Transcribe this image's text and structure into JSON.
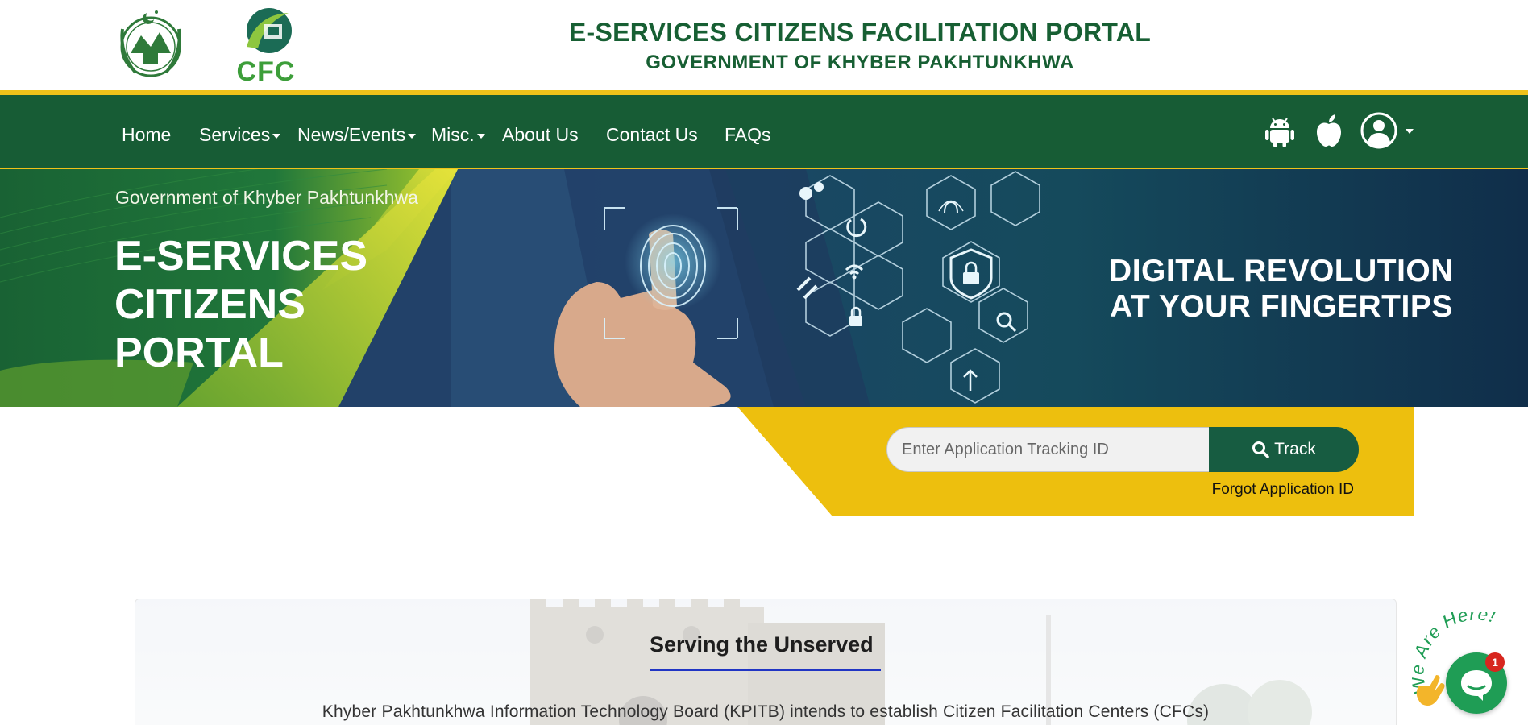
{
  "header": {
    "title": "E-SERVICES CITIZENS FACILITATION PORTAL",
    "subtitle": "GOVERNMENT OF KHYBER PAKHTUNKHWA",
    "cfc_logo_text": "CFC"
  },
  "nav": {
    "items": [
      {
        "label": "Home",
        "dropdown": false
      },
      {
        "label": "Services",
        "dropdown": true
      },
      {
        "label": "News/Events",
        "dropdown": true
      },
      {
        "label": "Misc.",
        "dropdown": true
      },
      {
        "label": "About Us",
        "dropdown": false
      },
      {
        "label": "Contact Us",
        "dropdown": false
      },
      {
        "label": "FAQs",
        "dropdown": false
      }
    ],
    "icons": [
      "android-icon",
      "apple-icon",
      "user-account-icon"
    ]
  },
  "hero": {
    "subtitle": "Government of Khyber Pakhtunkhwa",
    "title_lines": [
      "E-SERVICES",
      "CITIZENS",
      "PORTAL"
    ],
    "tagline_lines": [
      "DIGITAL REVOLUTION",
      "AT YOUR FINGERTIPS"
    ]
  },
  "track": {
    "placeholder": "Enter Application Tracking ID",
    "button_label": "Track",
    "forgot_label": "Forgot Application ID"
  },
  "section": {
    "title": "Serving the Unserved",
    "text": "Khyber Pakhtunkhwa Information Technology Board (KPITB) intends to establish Citizen Facilitation Centers (CFCs)"
  },
  "chat": {
    "banner": "We Are Here!",
    "unread_count": "1"
  },
  "colors": {
    "primary_green": "#175c35",
    "accent_yellow": "#efc21a",
    "title_green": "#175f33",
    "underline_blue": "#2035c4"
  }
}
